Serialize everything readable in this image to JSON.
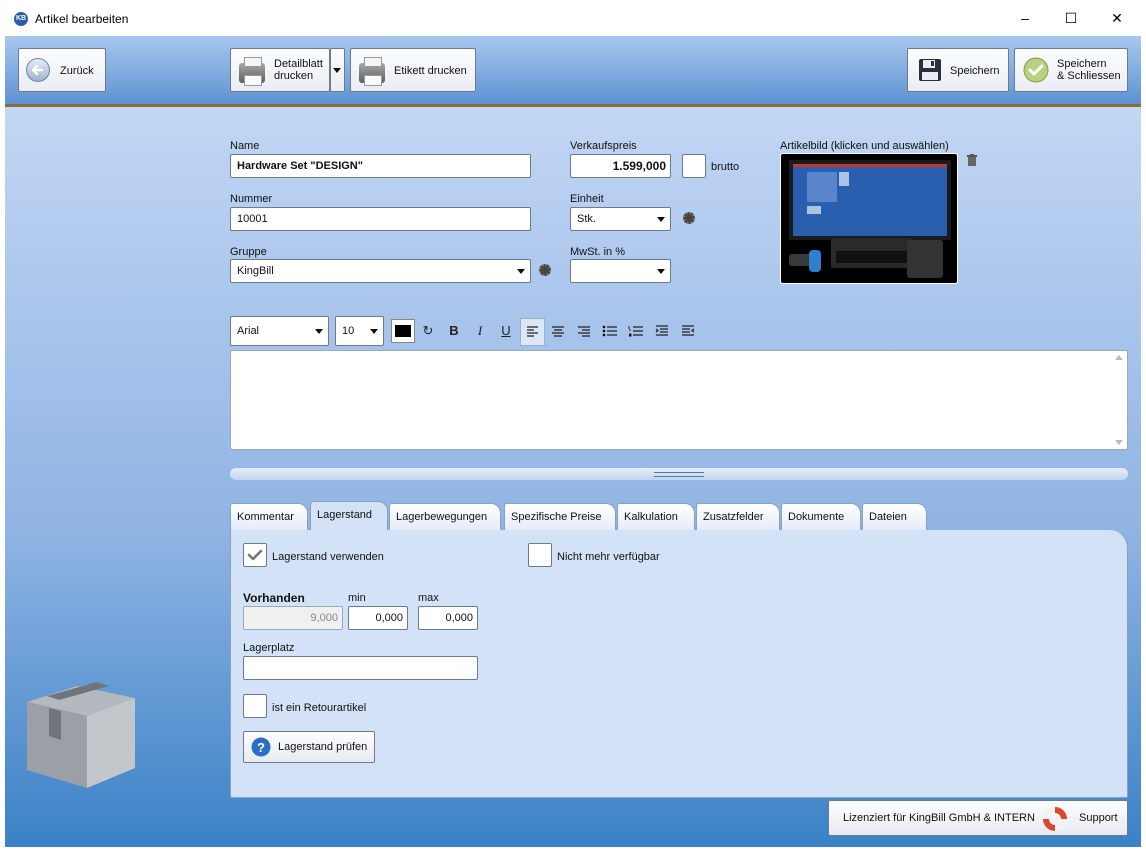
{
  "window": {
    "title": "Artikel bearbeiten",
    "app_icon_text": "KB",
    "minimize": "–",
    "maximize": "☐",
    "close": "✕"
  },
  "toolbar": {
    "back_label": "Zurück",
    "detail_label_1": "Detailblatt",
    "detail_label_2": "drucken",
    "label_print": "Etikett drucken",
    "save_label": "Speichern",
    "save_close_1": "Speichern",
    "save_close_2": "& Schliessen"
  },
  "form": {
    "name_label": "Name",
    "name_value": "Hardware Set \"DESIGN\"",
    "number_label": "Nummer",
    "number_value": "10001",
    "group_label": "Gruppe",
    "group_value": "KingBill",
    "price_label": "Verkaufspreis",
    "price_value": "1.599,000",
    "brutto_label": "brutto",
    "unit_label": "Einheit",
    "unit_value": "Stk.",
    "vat_label": "MwSt. in %",
    "vat_value": "",
    "image_label": "Artikelbild (klicken und auswählen)"
  },
  "editor": {
    "font": "Arial",
    "size": "10"
  },
  "tabs": [
    {
      "label": "Kommentar"
    },
    {
      "label": "Lagerstand"
    },
    {
      "label": "Lagerbewegungen"
    },
    {
      "label": "Spezifische Preise"
    },
    {
      "label": "Kalkulation"
    },
    {
      "label": "Zusatzfelder"
    },
    {
      "label": "Dokumente"
    },
    {
      "label": "Dateien"
    }
  ],
  "stock": {
    "use_stock_label": "Lagerstand verwenden",
    "not_available_label": "Nicht mehr verfügbar",
    "available_label": "Vorhanden",
    "min_label": "min",
    "max_label": "max",
    "available_value": "9,000",
    "min_value": "0,000",
    "max_value": "0,000",
    "location_label": "Lagerplatz",
    "location_value": "",
    "return_label": "ist ein Retourartikel",
    "check_button": "Lagerstand prüfen"
  },
  "footer": {
    "license_text": "Lizenziert für KingBill GmbH & INTERN",
    "support_label": "Support"
  },
  "colors": {
    "accent": "#3a82c6",
    "toolbar": "#5d92d3",
    "panel": "#d4e2f8"
  }
}
